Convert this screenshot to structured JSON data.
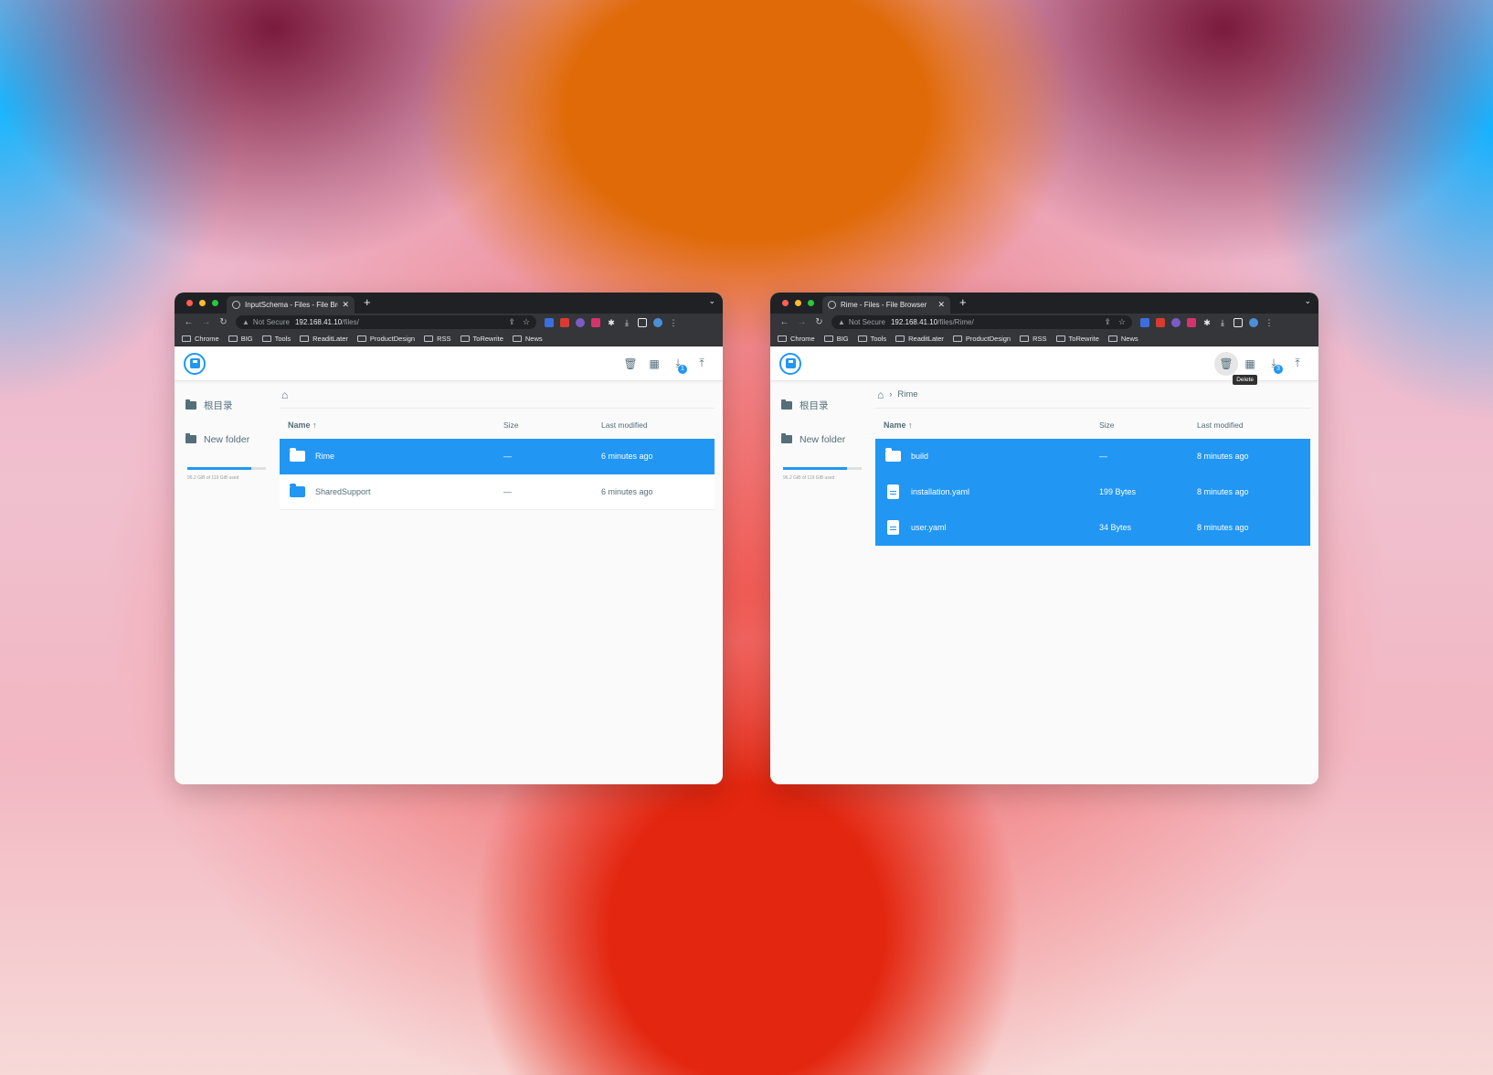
{
  "colors": {
    "accent": "#2196f3",
    "toolbar_dark": "#202124",
    "text": "#546e7a"
  },
  "left": {
    "tab_title": "InputSchema - Files - File Brow",
    "url_host": "192.168.41.10",
    "url_path": "/files/",
    "not_secure": "Not Secure",
    "bookmarks": [
      "Chrome",
      "BIG",
      "Tools",
      "ReaditLater",
      "ProductDesign",
      "RSS",
      "ToRewrite",
      "News"
    ],
    "download_badge": "1",
    "sidebar": {
      "root": "根目录",
      "new_folder": "New folder",
      "usage_text": "96.2 GiB of 119 GiB used",
      "usage_fraction": 0.81
    },
    "breadcrumb": [],
    "columns": {
      "name": "Name",
      "size": "Size",
      "modified": "Last modified"
    },
    "rows": [
      {
        "name": "Rime",
        "size": "—",
        "modified": "6 minutes ago",
        "type": "folder",
        "selected": true
      },
      {
        "name": "SharedSupport",
        "size": "—",
        "modified": "6 minutes ago",
        "type": "folder",
        "selected": false
      }
    ]
  },
  "right": {
    "tab_title": "Rime - Files - File Browser",
    "url_host": "192.168.41.10",
    "url_path": "/files/Rime/",
    "not_secure": "Not Secure",
    "bookmarks": [
      "Chrome",
      "BIG",
      "Tools",
      "ReaditLater",
      "ProductDesign",
      "RSS",
      "ToRewrite",
      "News"
    ],
    "download_badge": "3",
    "tooltip": "Delete",
    "sidebar": {
      "root": "根目录",
      "new_folder": "New folder",
      "usage_text": "96.2 GiB of 119 GiB used",
      "usage_fraction": 0.81
    },
    "breadcrumb": [
      "Rime"
    ],
    "columns": {
      "name": "Name",
      "size": "Size",
      "modified": "Last modified"
    },
    "rows": [
      {
        "name": "build",
        "size": "—",
        "modified": "8 minutes ago",
        "type": "folder",
        "selected": true
      },
      {
        "name": "installation.yaml",
        "size": "199 Bytes",
        "modified": "8 minutes ago",
        "type": "file",
        "selected": true
      },
      {
        "name": "user.yaml",
        "size": "34 Bytes",
        "modified": "8 minutes ago",
        "type": "file",
        "selected": true
      }
    ]
  }
}
